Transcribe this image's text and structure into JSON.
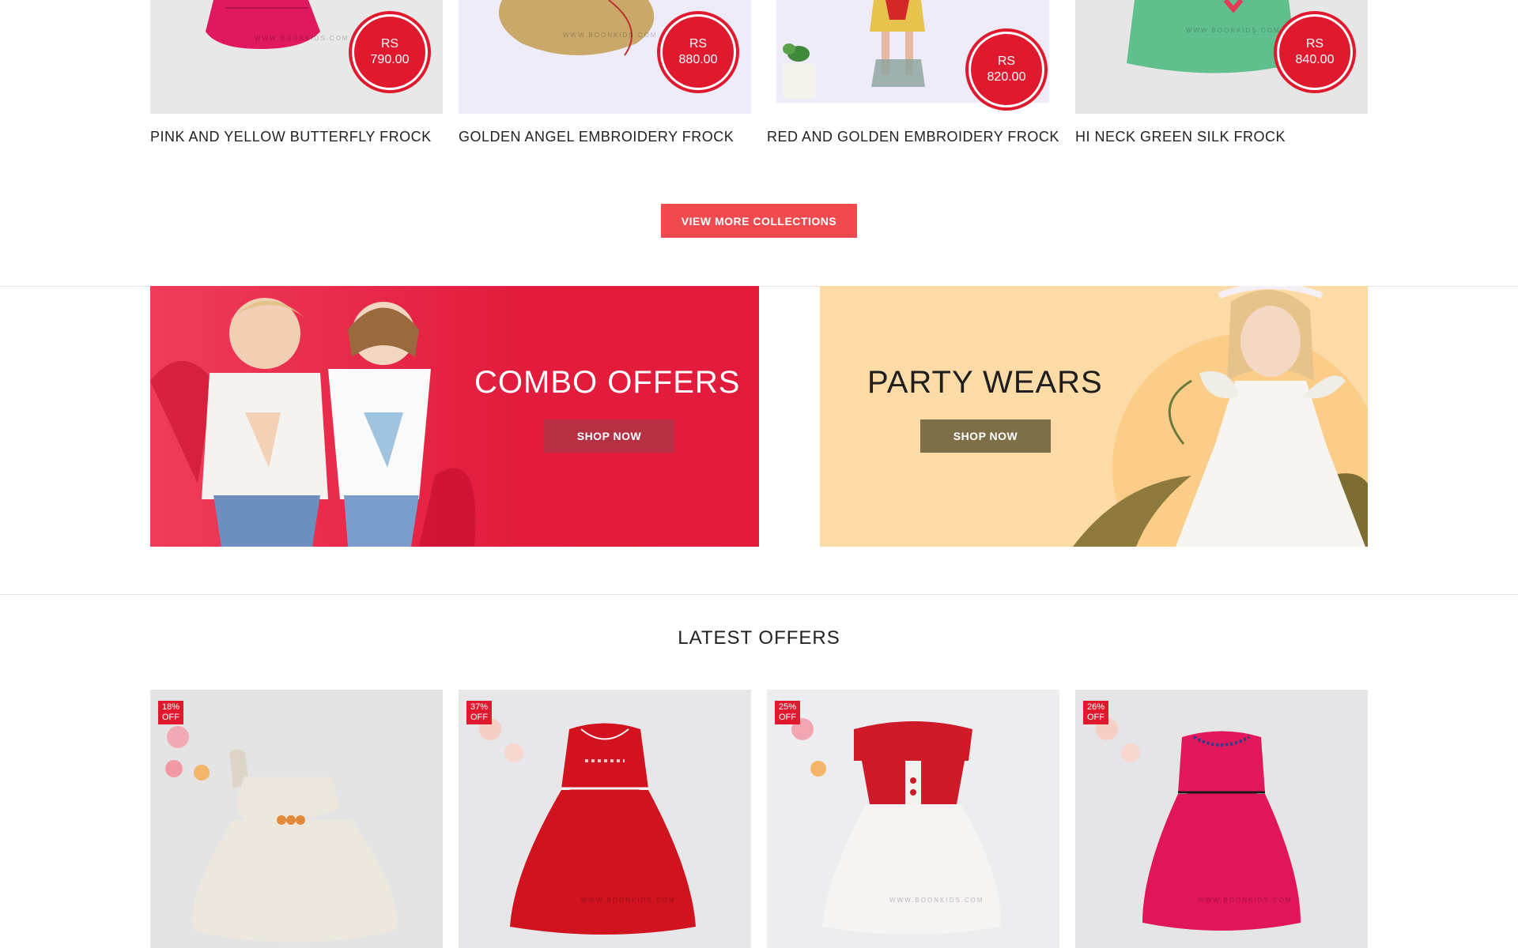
{
  "products": [
    {
      "name": "PINK AND YELLOW BUTTERFLY FROCK",
      "currency": "RS",
      "price": "790.00"
    },
    {
      "name": "GOLDEN ANGEL EMBROIDERY FROCK",
      "currency": "RS",
      "price": "880.00"
    },
    {
      "name": "RED AND GOLDEN EMBROIDERY FROCK",
      "currency": "RS",
      "price": "820.00"
    },
    {
      "name": "HI NECK GREEN SILK FROCK",
      "currency": "RS",
      "price": "840.00"
    }
  ],
  "watermark": "WWW.BOONKIDS.COM",
  "view_more_label": "VIEW MORE COLLECTIONS",
  "banners": {
    "combo": {
      "title": "COMBO OFFERS",
      "button": "SHOP NOW"
    },
    "party": {
      "title": "PARTY WEARS",
      "button": "SHOP NOW"
    }
  },
  "latest_offers": {
    "title": "LATEST OFFERS",
    "items": [
      {
        "discount": "18%",
        "off": "OFF"
      },
      {
        "discount": "37%",
        "off": "OFF"
      },
      {
        "discount": "25%",
        "off": "OFF"
      },
      {
        "discount": "26%",
        "off": "OFF"
      }
    ]
  },
  "colors": {
    "accent_red": "#e1192e",
    "button_coral": "#f04a4e",
    "party_bg": "#fcdba6",
    "party_button": "#7d7048"
  }
}
